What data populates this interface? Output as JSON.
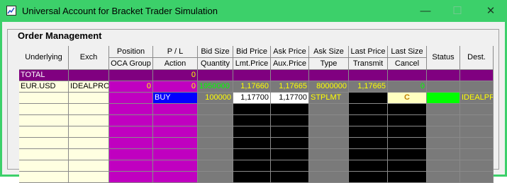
{
  "window": {
    "title": "Universal Account for Bracket Trader Simulation",
    "minimize_glyph": "—",
    "maximize_glyph": "☐",
    "close_glyph": "✕"
  },
  "group": {
    "label": "Order Management"
  },
  "colors": {
    "window": "#3cd06a",
    "total_row": "#800080",
    "magenta": "#c000c0",
    "gray_col": "#7a7a7a",
    "black": "#000000",
    "white": "#ffffff",
    "row_input": "#ffffe1",
    "buy": "#0000ff",
    "green_text": "#00ff00",
    "yellow_text": "#ffff00",
    "cancel_bg": "#ffffc0",
    "status_bg": "#00ff00"
  },
  "grid": {
    "columns": [
      {
        "key": "underlying",
        "header1": "",
        "header2": "Underlying"
      },
      {
        "key": "exch",
        "header1": "",
        "header2": "Exch"
      },
      {
        "key": "position",
        "header1": "Position",
        "header2": "OCA Group"
      },
      {
        "key": "pl",
        "header1": "P / L",
        "header2": "Action"
      },
      {
        "key": "bid_size",
        "header1": "Bid Size",
        "header2": "Quantity"
      },
      {
        "key": "bid_price",
        "header1": "Bid Price",
        "header2": "Lmt.Price"
      },
      {
        "key": "ask_price",
        "header1": "Ask Price",
        "header2": "Aux.Price"
      },
      {
        "key": "ask_size",
        "header1": "Ask Size",
        "header2": "Type"
      },
      {
        "key": "last_price",
        "header1": "Last Price",
        "header2": "Transmit"
      },
      {
        "key": "last_size",
        "header1": "Last Size",
        "header2": "Cancel"
      },
      {
        "key": "status",
        "header1": "",
        "header2": "Status"
      },
      {
        "key": "dest",
        "header1": "",
        "header2": "Dest."
      }
    ],
    "total_row": {
      "underlying": "TOTAL",
      "exch": "",
      "position": "",
      "pl": "0",
      "bid_size": "",
      "bid_price": "",
      "ask_price": "",
      "ask_size": "",
      "last_price": "",
      "last_size": "",
      "status": "",
      "dest": ""
    },
    "instrument_row": {
      "underlying": "EUR.USD",
      "exch": "IDEALPRO",
      "position": "0",
      "pl": "0",
      "bid_size": "1950000",
      "bid_price": "1,17660",
      "ask_price": "1,17665",
      "ask_size": "8000000",
      "last_price": "1,17665",
      "last_size": "0",
      "status": "",
      "dest": ""
    },
    "order_row": {
      "underlying": "",
      "exch": "",
      "oca_group": "",
      "action": "BUY",
      "quantity": "100000",
      "lmt_price": "1,17700",
      "aux_price": "1,17700",
      "type": "STPLMT",
      "transmit": "",
      "cancel": "C",
      "status": "",
      "dest": "IDEALPR"
    },
    "empty_rows": 7
  }
}
